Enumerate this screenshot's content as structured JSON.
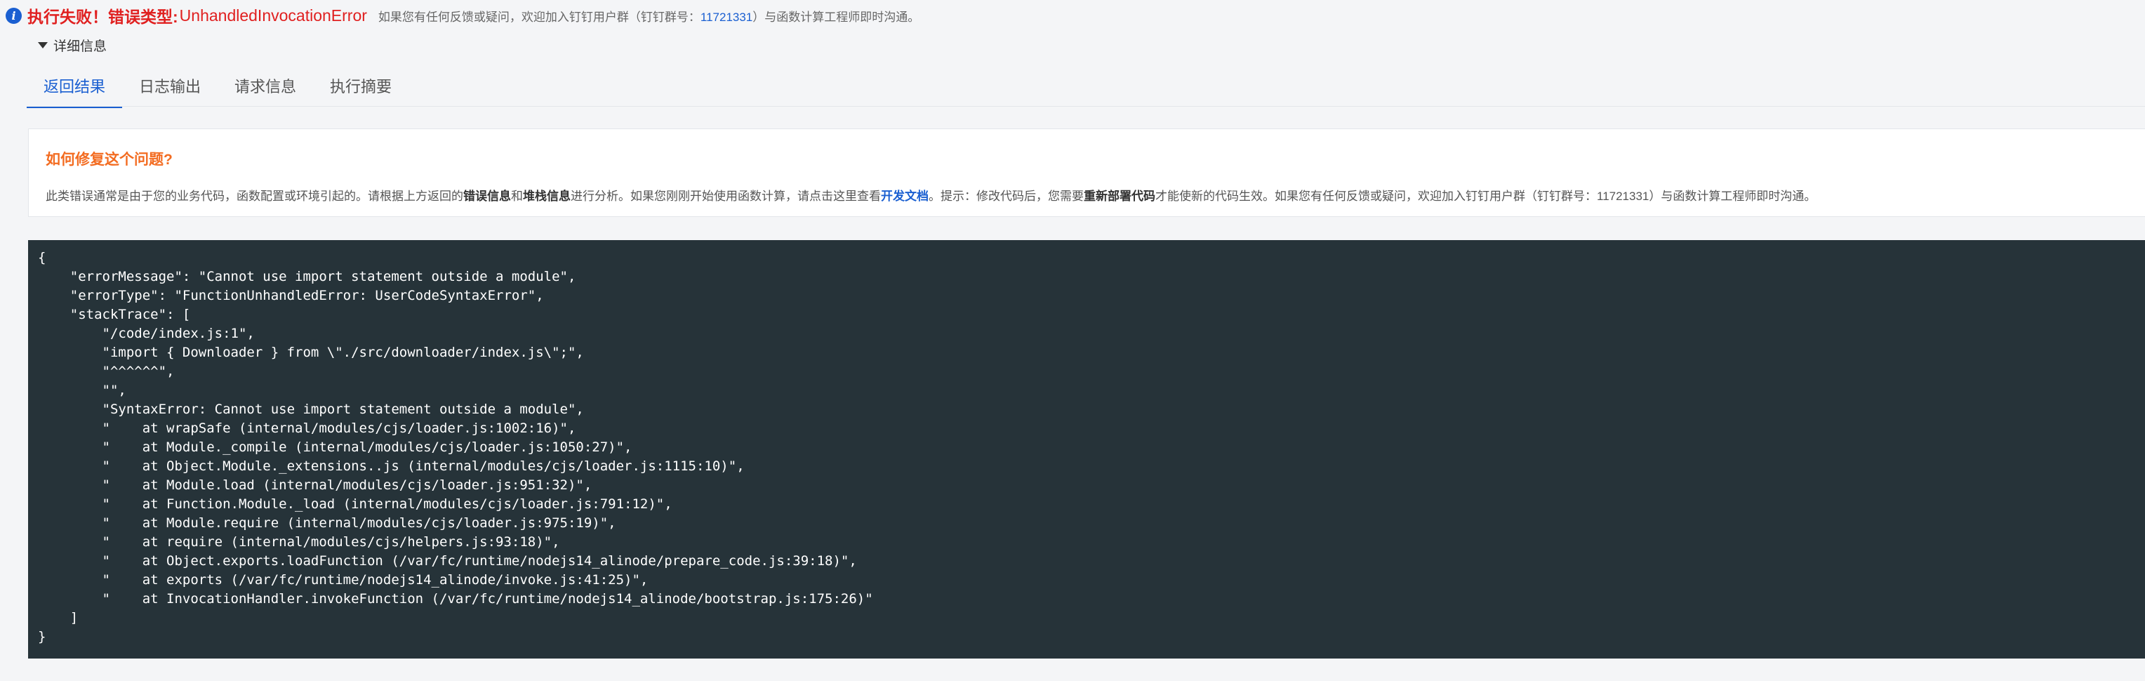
{
  "header": {
    "icon": "info-icon",
    "error_prefix": "执行失败！错误类型:",
    "error_type": "UnhandledInvocationError",
    "hint_before": "如果您有任何反馈或疑问，欢迎加入钉钉用户群（钉钉群号：",
    "hint_group": "11721331",
    "hint_after": "）与函数计算工程师即时沟通。"
  },
  "details": {
    "label": "详细信息",
    "icon": "caret-down-icon"
  },
  "tabs": [
    {
      "label": "返回结果",
      "active": true
    },
    {
      "label": "日志输出",
      "active": false
    },
    {
      "label": "请求信息",
      "active": false
    },
    {
      "label": "执行摘要",
      "active": false
    }
  ],
  "help": {
    "title": "如何修复这个问题?",
    "text_1": "此类错误通常是由于您的业务代码，函数配置或环境引起的。请根据上方返回的",
    "bold_1": "错误信息",
    "text_2": "和",
    "bold_2": "堆栈信息",
    "text_3": "进行分析。如果您刚刚开始使用函数计算，请点击这里查看",
    "link": "开发文档",
    "text_4": "。提示：修改代码后，您需要",
    "bold_3": "重新部署代码",
    "text_5": "才能使新的代码生效。如果您有任何反馈或疑问，欢迎加入钉钉用户群（钉钉群号：11721331）与函数计算工程师即时沟通。"
  },
  "code": {
    "text": "{\n    \"errorMessage\": \"Cannot use import statement outside a module\",\n    \"errorType\": \"FunctionUnhandledError: UserCodeSyntaxError\",\n    \"stackTrace\": [\n        \"/code/index.js:1\",\n        \"import { Downloader } from \\\"./src/downloader/index.js\\\";\",\n        \"^^^^^^\",\n        \"\",\n        \"SyntaxError: Cannot use import statement outside a module\",\n        \"    at wrapSafe (internal/modules/cjs/loader.js:1002:16)\",\n        \"    at Module._compile (internal/modules/cjs/loader.js:1050:27)\",\n        \"    at Object.Module._extensions..js (internal/modules/cjs/loader.js:1115:10)\",\n        \"    at Module.load (internal/modules/cjs/loader.js:951:32)\",\n        \"    at Function.Module._load (internal/modules/cjs/loader.js:791:12)\",\n        \"    at Module.require (internal/modules/cjs/loader.js:975:19)\",\n        \"    at require (internal/modules/cjs/helpers.js:93:18)\",\n        \"    at Object.exports.loadFunction (/var/fc/runtime/nodejs14_alinode/prepare_code.js:39:18)\",\n        \"    at exports (/var/fc/runtime/nodejs14_alinode/invoke.js:41:25)\",\n        \"    at InvocationHandler.invokeFunction (/var/fc/runtime/nodejs14_alinode/bootstrap.js:175:26)\"\n    ]\n}"
  },
  "colors": {
    "error": "#e02020",
    "accent": "#1a5fd1",
    "help_title": "#f36c21",
    "code_bg": "#263339"
  }
}
